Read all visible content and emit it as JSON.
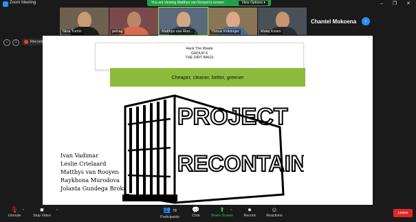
{
  "window": {
    "title": "Zoom Meeting",
    "controls": [
      "–",
      "❐",
      "✕"
    ]
  },
  "banner": {
    "text": "You are viewing Matthys van Rooyen's screen",
    "view_options": "View Options ▾"
  },
  "participants": [
    {
      "name": "Nina Turčin",
      "bg": "#6e6150",
      "body": "#1c1c1c"
    },
    {
      "name": "petrag",
      "bg": "#7a4a4a",
      "body": "#d96b4c"
    },
    {
      "name": "Matthys van Roo...",
      "bg": "#5a6a7c",
      "body": "#2f3a4a"
    },
    {
      "name": "Thinus Kritzinger",
      "bg": "#8a7656",
      "body": "#4a6a9a"
    },
    {
      "name": "Matej Koren",
      "bg": "#4a5058",
      "body": "#2c2c2c"
    }
  ],
  "active_speaker": "Chantel Mokoena",
  "next_icon": "chevron-right-icon",
  "recording_label": "Recording...",
  "slide": {
    "header_lines": [
      "Hack The Waste",
      "GROUP 6",
      "THE DIRT BAGS"
    ],
    "tagline": "Cheaper, cleaner, better, greener",
    "logo_line1": "PROJECT",
    "logo_line2": "RECONTAIN",
    "team": [
      "Ivan Vadimar",
      "Leslie Crielaard",
      "Matthys van Rooyen",
      "Raykhona Murodova",
      "Jolanta Gundega Broka"
    ]
  },
  "toolbar": {
    "unmute": "Unmute",
    "stop_video": "Stop Video",
    "participants": "Participants",
    "participants_count": "78",
    "chat": "Chat",
    "share_screen": "Share Screen",
    "record": "Record",
    "reactions": "Reactions",
    "leave": "Leave"
  },
  "colors": {
    "zoom_blue": "#2d8cff",
    "share_green": "#23a047",
    "slide_green": "#8cba3b",
    "leave_red": "#e02828"
  }
}
